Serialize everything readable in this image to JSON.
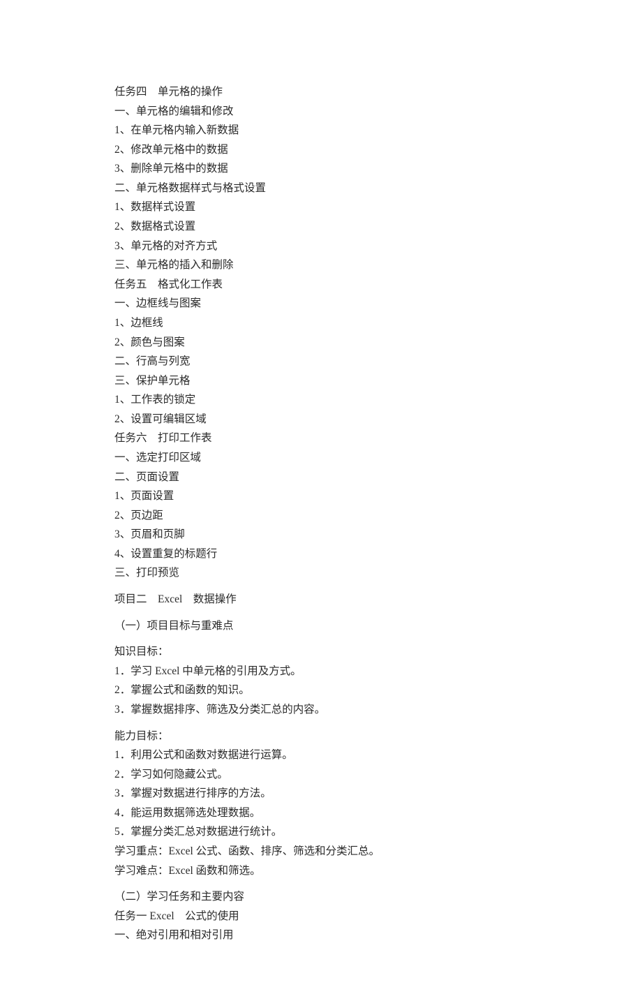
{
  "lines": [
    "任务四　单元格的操作",
    "一、单元格的编辑和修改",
    "1、在单元格内输入新数据",
    "2、修改单元格中的数据",
    "3、删除单元格中的数据",
    "二、单元格数据样式与格式设置",
    "1、数据样式设置",
    "2、数据格式设置",
    "3、单元格的对齐方式",
    "三、单元格的插入和删除",
    "任务五　格式化工作表",
    "一、边框线与图案",
    "1、边框线",
    "2、颜色与图案",
    "二、行高与列宽",
    "三、保护单元格",
    "1、工作表的锁定",
    "2、设置可编辑区域",
    "任务六　打印工作表",
    "一、选定打印区域",
    "二、页面设置",
    "1、页面设置",
    "2、页边距",
    "3、页眉和页脚",
    "4、设置重复的标题行",
    "三、打印预览",
    "项目二　Excel　数据操作",
    "（一）项目目标与重难点",
    "知识目标：",
    "1．学习 Excel 中单元格的引用及方式。",
    "2．掌握公式和函数的知识。",
    "3．掌握数据排序、筛选及分类汇总的内容。",
    "能力目标：",
    "1．利用公式和函数对数据进行运算。",
    "2．学习如何隐藏公式。",
    "3．掌握对数据进行排序的方法。",
    "4．能运用数据筛选处理数据。",
    "5．掌握分类汇总对数据进行统计。",
    "学习重点：Excel 公式、函数、排序、筛选和分类汇总。",
    "学习难点：Excel 函数和筛选。",
    "（二）学习任务和主要内容",
    "任务一 Excel　公式的使用",
    "一、绝对引用和相对引用"
  ],
  "gaps": [
    26,
    27,
    28,
    32,
    40
  ]
}
